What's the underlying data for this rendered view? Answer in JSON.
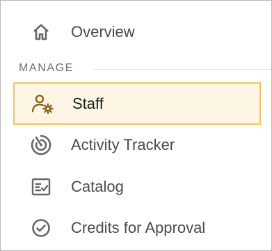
{
  "nav": {
    "overview": {
      "label": "Overview",
      "icon": "home-icon"
    },
    "section": {
      "label": "MANAGE"
    },
    "items": [
      {
        "label": "Staff",
        "icon": "staff-settings-icon",
        "selected": true
      },
      {
        "label": "Activity Tracker",
        "icon": "activity-tracker-icon",
        "selected": false
      },
      {
        "label": "Catalog",
        "icon": "catalog-icon",
        "selected": false
      },
      {
        "label": "Credits for Approval",
        "icon": "check-circle-icon",
        "selected": false
      }
    ]
  },
  "colors": {
    "selected_background": "#fdf6e5",
    "selected_border": "#f0c55e",
    "selected_icon": "#8a6417",
    "icon": "#666666",
    "text": "#4a4a4a"
  }
}
